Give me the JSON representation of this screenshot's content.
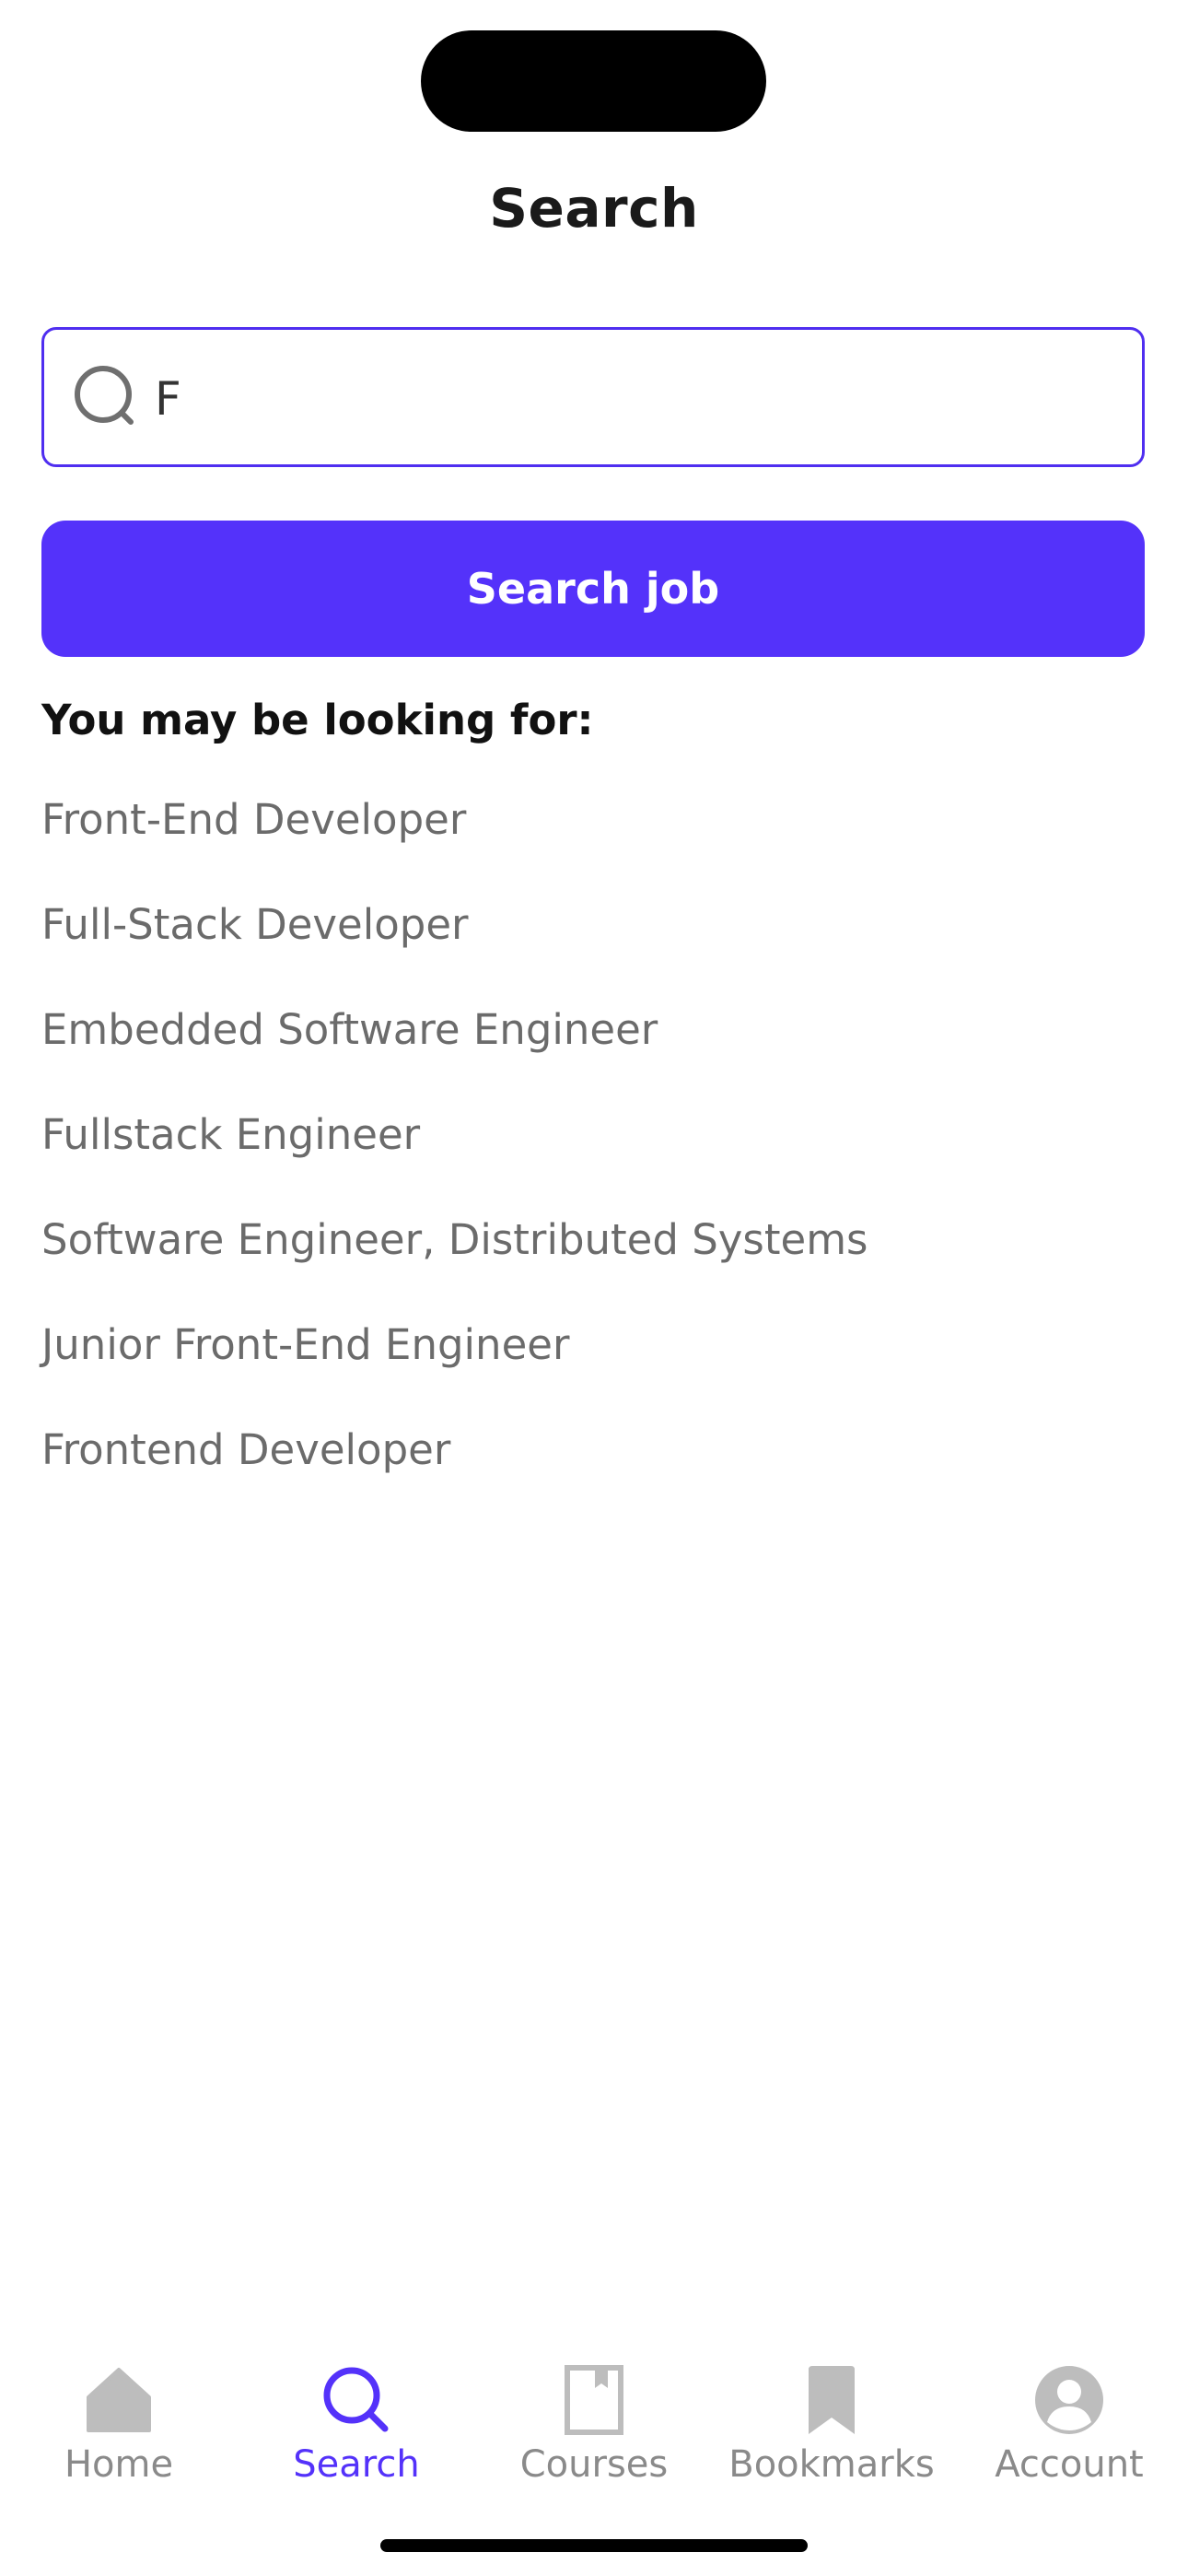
{
  "header": {
    "title": "Search"
  },
  "search": {
    "value": "F",
    "placeholder": "",
    "button_label": "Search job"
  },
  "suggestions": {
    "heading": "You may be looking for:",
    "items": [
      "Front-End Developer",
      "Full-Stack Developer",
      "Embedded Software Engineer",
      "Fullstack Engineer",
      "Software Engineer, Distributed Systems",
      "Junior Front-End Engineer",
      "Frontend Developer"
    ]
  },
  "tab_bar": {
    "active": "Search",
    "tabs": [
      {
        "label": "Home",
        "icon": "home-icon"
      },
      {
        "label": "Search",
        "icon": "search-icon"
      },
      {
        "label": "Courses",
        "icon": "book-icon"
      },
      {
        "label": "Bookmarks",
        "icon": "bookmark-icon"
      },
      {
        "label": "Account",
        "icon": "account-icon"
      }
    ]
  },
  "colors": {
    "accent": "#5432fa",
    "inactive": "#8a8a8a",
    "text_muted": "#6b6b6b"
  }
}
